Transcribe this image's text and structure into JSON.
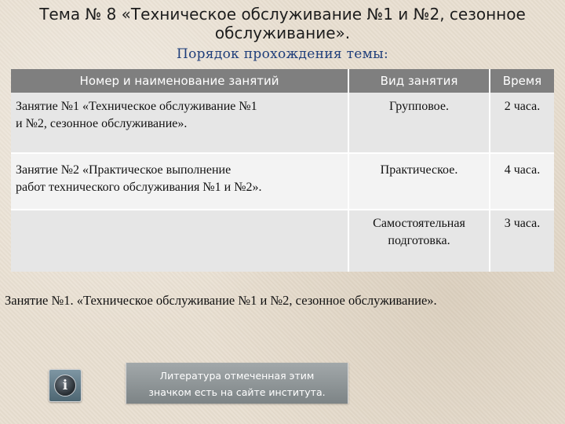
{
  "slide": {
    "title_line1": "Тема № 8 «Техническое обслуживание №1 и №2, сезонное",
    "title_line2": "обслуживание».",
    "subtitle": "Порядок прохождения темы:"
  },
  "table": {
    "headers": {
      "name": "Номер и наименование занятий",
      "type": "Вид занятия",
      "time": "Время"
    },
    "rows": [
      {
        "name_line1": "Занятие №1 «Техническое обслуживание №1",
        "name_line2": "и №2, сезонное обслуживание».",
        "type_line1": "Групповое.",
        "type_line2": "",
        "time": "2 часа."
      },
      {
        "name_line1": "Занятие №2 «Практическое выполнение",
        "name_line2": "работ технического обслуживания №1 и №2».",
        "type_line1": "Практическое.",
        "type_line2": "",
        "time": "4 часа."
      },
      {
        "name_line1": "",
        "name_line2": "",
        "type_line1": "Самостоятельная",
        "type_line2": "подготовка.",
        "time": "3 часа."
      }
    ]
  },
  "lesson_heading": "Занятие №1. «Техническое обслуживание №1 и №2, сезонное обслуживание».",
  "info": {
    "icon": "info-icon",
    "glyph": "i",
    "note_line1": "Литература отмеченная этим",
    "note_line2": "значком есть на сайте института."
  }
}
